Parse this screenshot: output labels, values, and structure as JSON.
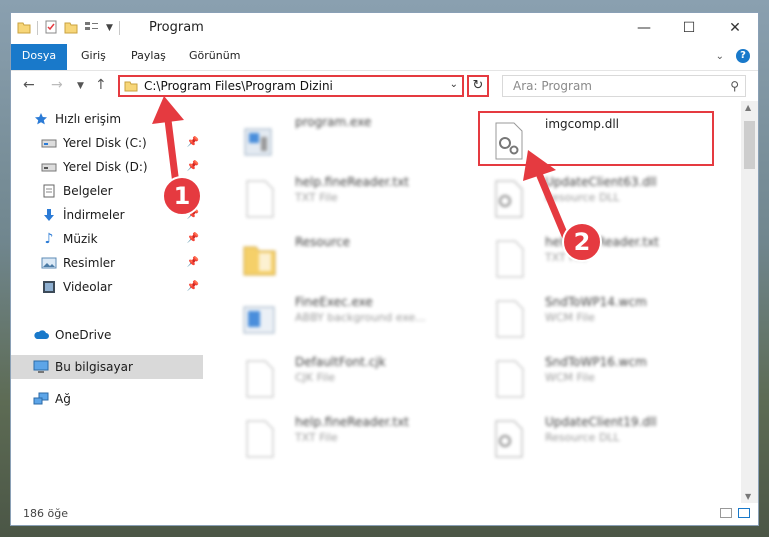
{
  "window": {
    "title": "Program",
    "controls": {
      "minimize": "—",
      "maximize": "☐",
      "close": "✕"
    }
  },
  "ribbon": {
    "tabs": [
      "Dosya",
      "Giriş",
      "Paylaş",
      "Görünüm"
    ],
    "help": "?"
  },
  "address": {
    "path": "C:\\Program Files\\Program Dizini",
    "search_placeholder": "Ara: Program"
  },
  "nav": {
    "items": [
      {
        "label": "Hızlı erişim",
        "icon": "star-icon",
        "pinned": false
      },
      {
        "label": "Yerel Disk (C:)",
        "icon": "drive-icon",
        "pinned": true
      },
      {
        "label": "Yerel Disk (D:)",
        "icon": "drive-icon",
        "pinned": true
      },
      {
        "label": "Belgeler",
        "icon": "documents-icon",
        "pinned": true
      },
      {
        "label": "İndirmeler",
        "icon": "download-icon",
        "pinned": true
      },
      {
        "label": "Müzik",
        "icon": "music-icon",
        "pinned": true
      },
      {
        "label": "Resimler",
        "icon": "pictures-icon",
        "pinned": true
      },
      {
        "label": "Videolar",
        "icon": "video-icon",
        "pinned": true
      },
      {
        "label": "OneDrive",
        "icon": "cloud-icon",
        "pinned": false
      },
      {
        "label": "Bu bilgisayar",
        "icon": "computer-icon",
        "pinned": false,
        "selected": true
      },
      {
        "label": "Ağ",
        "icon": "network-icon",
        "pinned": false
      }
    ]
  },
  "files": {
    "left": [
      {
        "name": "program.exe",
        "type": "",
        "icon": "exe-icon"
      },
      {
        "name": "help.fineReader.txt",
        "type": "TXT File",
        "icon": "text-file-icon"
      },
      {
        "name": "Resource",
        "type": "",
        "icon": "folder-icon"
      },
      {
        "name": "FineExec.exe",
        "type": "ABBY background exe...",
        "icon": "exe-icon"
      },
      {
        "name": "DefaultFont.cjk",
        "type": "CJK File",
        "icon": "blank-file-icon"
      },
      {
        "name": "help.fineReader.txt",
        "type": "TXT File",
        "icon": "text-file-icon"
      }
    ],
    "right": [
      {
        "name": "imgcomp.dll",
        "type": "",
        "icon": "dll-gear-icon"
      },
      {
        "name": "UpdateClient63.dll",
        "type": "Resource DLL",
        "icon": "dll-gear-icon"
      },
      {
        "name": "help.fineReader.txt",
        "type": "TXT File",
        "icon": "text-file-icon"
      },
      {
        "name": "SndToWP14.wcm",
        "type": "WCM File",
        "icon": "blank-file-icon"
      },
      {
        "name": "SndToWP16.wcm",
        "type": "WCM File",
        "icon": "blank-file-icon"
      },
      {
        "name": "UpdateClient19.dll",
        "type": "Resource DLL",
        "icon": "dll-gear-icon"
      }
    ]
  },
  "status": {
    "count": "186 öğe"
  },
  "annotations": {
    "badge1": "1",
    "badge2": "2",
    "color": "#e53a40"
  }
}
